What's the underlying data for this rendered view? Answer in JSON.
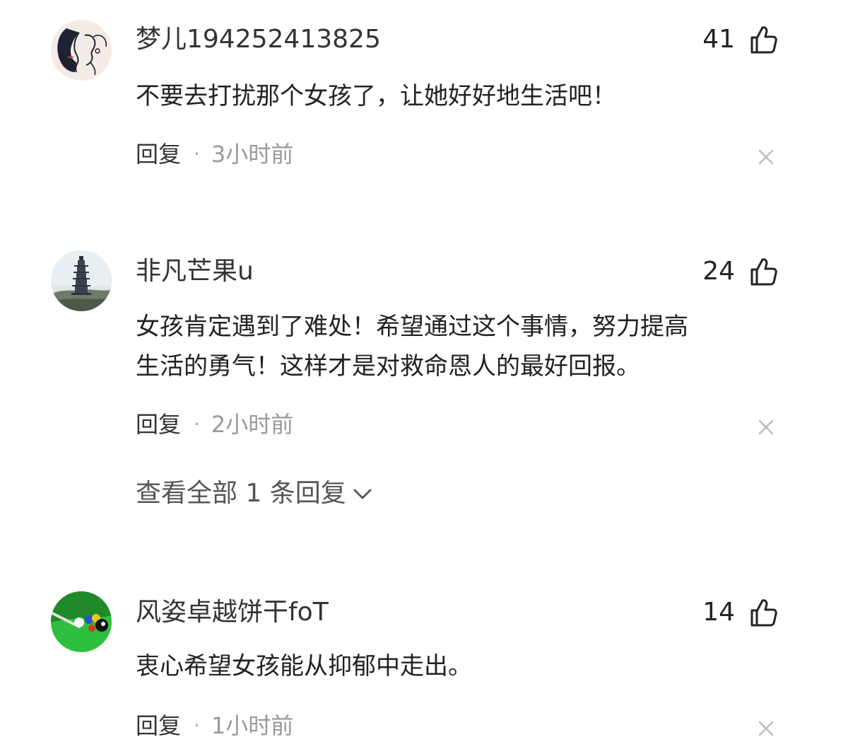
{
  "comments": [
    {
      "username": "梦儿194252413825",
      "likes": "41",
      "content": "不要去打扰那个女孩了，让她好好地生活吧！",
      "reply_label": "回复",
      "separator": "·",
      "time": "3小时前",
      "avatar_icon": "line-art-faces-avatar"
    },
    {
      "username": "非凡芒果u",
      "likes": "24",
      "content": "女孩肯定遇到了难处！希望通过这个事情，努力提高\n生活的勇气！这样才是对救命恩人的最好回报。",
      "reply_label": "回复",
      "separator": "·",
      "time": "2小时前",
      "avatar_icon": "pagoda-avatar",
      "view_all_replies": "查看全部 1 条回复"
    },
    {
      "username": "风姿卓越饼干foT",
      "likes": "14",
      "content": "衷心希望女孩能从抑郁中走出。",
      "reply_label": "回复",
      "separator": "·",
      "time": "1小时前",
      "avatar_icon": "billiards-avatar"
    }
  ],
  "icons": {
    "like": "thumbs-up-icon",
    "dismiss": "close-icon",
    "expand": "chevron-down-icon"
  },
  "colors": {
    "username": "#333333",
    "content": "#222222",
    "time": "#999999",
    "close": "#bbbbbb"
  }
}
